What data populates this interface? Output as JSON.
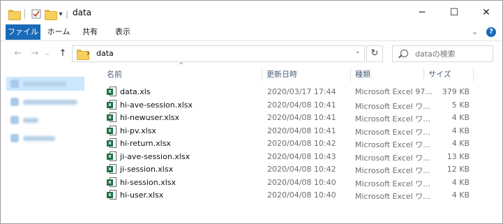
{
  "window": {
    "title": "data",
    "title_prefix_sep": "|",
    "qat_dropdown": "▾",
    "controls": {
      "minimize": "─",
      "maximize": "☐",
      "close": "✕"
    }
  },
  "ribbon": {
    "tabs": [
      "ファイル",
      "ホーム",
      "共有",
      "表示"
    ],
    "expand": "⌄",
    "help": "?"
  },
  "address": {
    "back": "←",
    "forward": "→",
    "recent": "⌄",
    "up": "↑",
    "chevron": "›",
    "path": "data",
    "dropdown": "⌄",
    "refresh": "↻",
    "search_placeholder": "dataの検索"
  },
  "columns": {
    "name": "名前",
    "date": "更新日時",
    "type": "種類",
    "size": "サイズ",
    "sort_indicator": "^"
  },
  "files": [
    {
      "name": "data.xls",
      "date": "2020/03/17 17:44",
      "type": "Microsoft Excel 97...",
      "size": "379 KB",
      "icon": "excel-97-icon"
    },
    {
      "name": "hi-ave-session.xlsx",
      "date": "2020/04/08 10:41",
      "type": "Microsoft Excel ワ...",
      "size": "5 KB",
      "icon": "excel-icon"
    },
    {
      "name": "hi-newuser.xlsx",
      "date": "2020/04/08 10:41",
      "type": "Microsoft Excel ワ...",
      "size": "4 KB",
      "icon": "excel-icon"
    },
    {
      "name": "hi-pv.xlsx",
      "date": "2020/04/08 10:41",
      "type": "Microsoft Excel ワ...",
      "size": "4 KB",
      "icon": "excel-icon"
    },
    {
      "name": "hi-return.xlsx",
      "date": "2020/04/08 10:42",
      "type": "Microsoft Excel ワ...",
      "size": "4 KB",
      "icon": "excel-icon"
    },
    {
      "name": "ji-ave-session.xlsx",
      "date": "2020/04/08 10:43",
      "type": "Microsoft Excel ワ...",
      "size": "13 KB",
      "icon": "excel-icon"
    },
    {
      "name": "ji-session.xlsx",
      "date": "2020/04/08 10:42",
      "type": "Microsoft Excel ワ...",
      "size": "12 KB",
      "icon": "excel-icon"
    },
    {
      "name": "hi-session.xlsx",
      "date": "2020/04/08 10:40",
      "type": "Microsoft Excel ワ...",
      "size": "4 KB",
      "icon": "excel-icon"
    },
    {
      "name": "hi-user.xlsx",
      "date": "2020/04/08 10:40",
      "type": "Microsoft Excel ワ...",
      "size": "4 KB",
      "icon": "excel-icon"
    }
  ],
  "colors": {
    "accent": "#1a6ab7",
    "excel_green": "#1d7044",
    "folder_yellow": "#f6cf5c",
    "nav_selected": "#cce8ff",
    "header_text": "#4c607a",
    "secondary_text": "#6d6d6d"
  }
}
